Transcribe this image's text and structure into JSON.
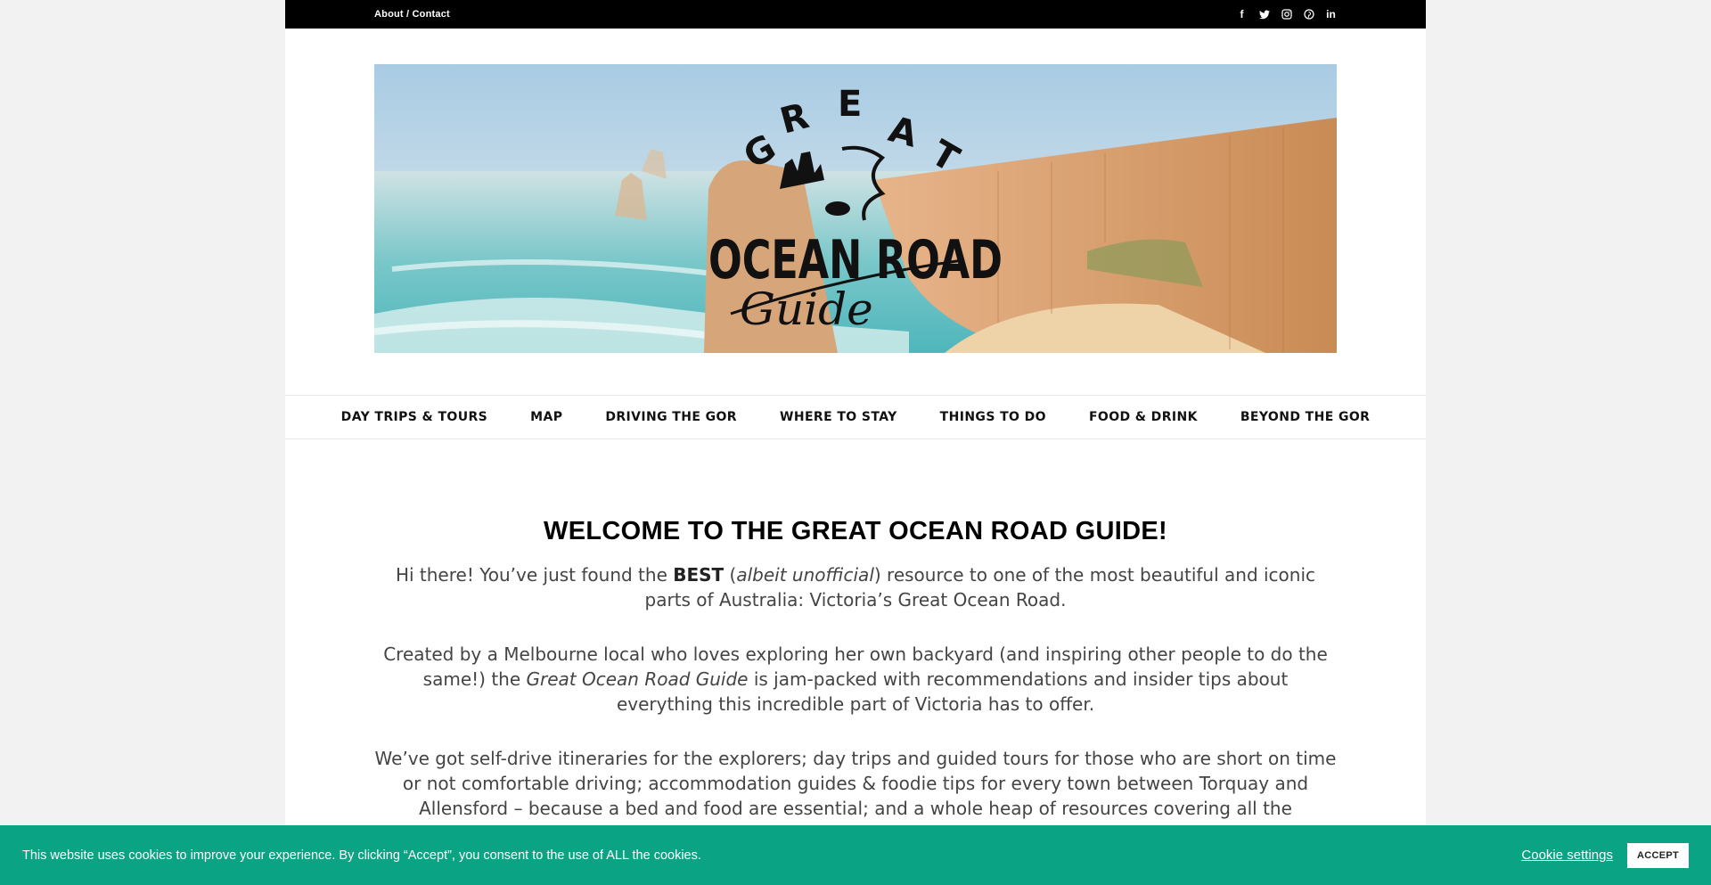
{
  "topbar": {
    "links_label": "About / Contact",
    "social": [
      {
        "icon": "facebook-icon",
        "glyph": "f"
      },
      {
        "icon": "twitter-icon",
        "glyph": "🐦"
      },
      {
        "icon": "instagram-icon",
        "glyph": "◎"
      },
      {
        "icon": "pinterest-icon",
        "glyph": "ⓟ"
      },
      {
        "icon": "linkedin-icon",
        "glyph": "in"
      }
    ]
  },
  "logo": {
    "arc_text": "GREAT",
    "main_text": "OCEAN ROAD",
    "script_text": "Guide"
  },
  "nav": {
    "items": [
      "DAY TRIPS & TOURS",
      "MAP",
      "DRIVING THE GOR",
      "WHERE TO STAY",
      "THINGS TO DO",
      "FOOD & DRINK",
      "BEYOND THE GOR"
    ]
  },
  "main": {
    "title": "WELCOME TO THE GREAT OCEAN ROAD GUIDE!",
    "p1_a": "Hi there! You’ve just found the ",
    "p1_b": "BEST",
    "p1_c": " (",
    "p1_d": "albeit unofficial",
    "p1_e": ") resource to one of the most beautiful and iconic parts of Australia: Victoria’s Great Ocean Road.",
    "p2_a": "Created by a Melbourne local who loves exploring her own backyard (and inspiring other people to do the same!) the ",
    "p2_b": "Great Ocean Road Guide",
    "p2_c": " is jam-packed with recommendations and insider tips about everything this incredible part of Victoria has to offer.",
    "p3": "We’ve got self-drive itineraries for the explorers; day trips and guided tours for those who are short on time or not comfortable driving; accommodation guides & foodie tips for every town between Torquay and Allensford – because a bed and food are essential; and a whole heap of resources covering all the incredible sights to see."
  },
  "cookie": {
    "message": "This website uses cookies to improve your experience. By clicking “Accept”, you consent to the use of ALL the cookies.",
    "settings_label": "Cookie settings",
    "accept_label": "ACCEPT"
  },
  "colors": {
    "cookie_bar": "#0aa383",
    "topbar": "#000000"
  }
}
